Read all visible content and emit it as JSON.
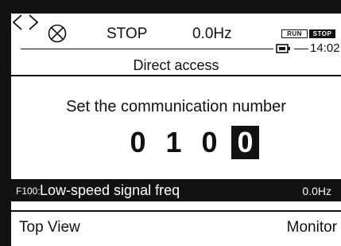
{
  "status": {
    "mode": "STOP",
    "frequency": "0.0Hz",
    "run_label": "RUN",
    "stop_label": "STOP",
    "time": "14:02"
  },
  "title": "Direct access",
  "prompt": "Set the communication number",
  "number": {
    "digits": [
      "0",
      "1",
      "0",
      "0"
    ],
    "selected_index": 3
  },
  "parameter": {
    "code": "F100:",
    "label": "Low-speed signal freq",
    "value": "0.0Hz"
  },
  "softkeys": {
    "left_label": "Top View",
    "right_label": "Monitor",
    "prev_icon": "chevron-left-icon",
    "next_icon": "chevron-right-icon"
  },
  "colors": {
    "foreground": "#111111",
    "background": "#ffffff"
  }
}
